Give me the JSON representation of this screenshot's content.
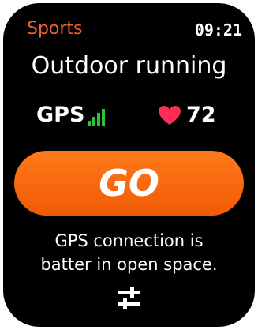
{
  "header": {
    "app_title": "Sports",
    "time": "09:21"
  },
  "activity": {
    "name": "Outdoor running"
  },
  "status": {
    "gps_label": "GPS",
    "gps_signal_icon": "signal-bars-icon",
    "gps_signal_level": 4,
    "heart_rate_icon": "heart-icon",
    "heart_rate": "72"
  },
  "go_button": {
    "label": "GO"
  },
  "hint": {
    "line1": "GPS connection is",
    "line2": "batter in open space."
  },
  "settings": {
    "icon": "sliders-icon"
  },
  "colors": {
    "accent": "#e8622a",
    "button": "#f76a0f",
    "signal": "#2ec13a",
    "heart": "#ff2d55",
    "background": "#000000"
  }
}
